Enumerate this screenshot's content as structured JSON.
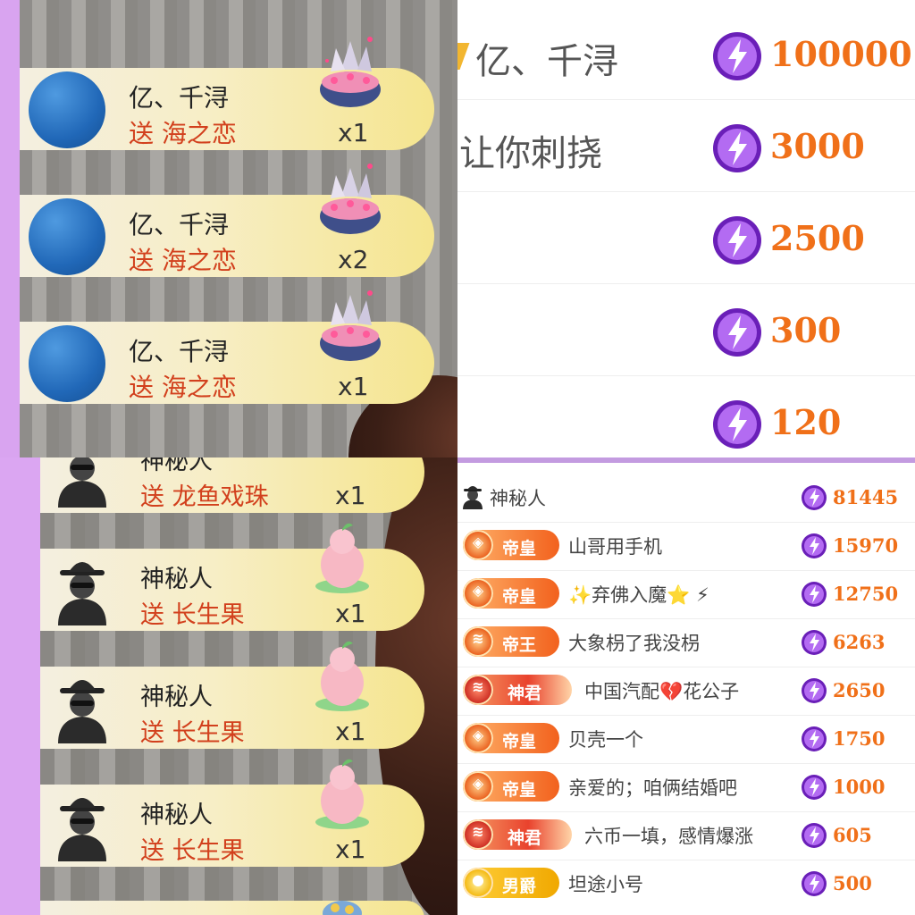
{
  "gift_feed_top": [
    {
      "name": "亿、千浔",
      "gift": "送 海之恋",
      "count": "x1"
    },
    {
      "name": "亿、千浔",
      "gift": "送 海之恋",
      "count": "x2"
    },
    {
      "name": "亿、千浔",
      "gift": "送 海之恋",
      "count": "x1"
    }
  ],
  "gift_feed_bottom": [
    {
      "name": "神秘人",
      "gift": "送 龙鱼戏珠",
      "count": "x1"
    },
    {
      "name": "神秘人",
      "gift": "送 长生果",
      "count": "x1"
    },
    {
      "name": "神秘人",
      "gift": "送 长生果",
      "count": "x1"
    },
    {
      "name": "神秘人",
      "gift": "送 长生果",
      "count": "x1"
    }
  ],
  "ranking_big": [
    {
      "name": "亿、千浔",
      "value": "100000"
    },
    {
      "name": "让你刺挠",
      "value": "3000"
    },
    {
      "name": "",
      "value": "2500"
    },
    {
      "name": "",
      "value": "300"
    },
    {
      "name": "",
      "value": "120"
    }
  ],
  "ranking_small": [
    {
      "badge": "",
      "badge_icon": "mystery-avatar-icon",
      "name": "神秘人",
      "value": "81445"
    },
    {
      "badge": "帝皇",
      "badge_icon": "diamond-icon",
      "name": "山哥用手机",
      "value": "15970"
    },
    {
      "badge": "帝皇",
      "badge_icon": "diamond-icon",
      "name": "✨弃佛入魔⭐ ⚡",
      "value": "12750"
    },
    {
      "badge": "帝王",
      "badge_icon": "chevron-icon",
      "name": "大象枴了我没枴",
      "value": "6263"
    },
    {
      "badge": "神君",
      "badge_icon": "chevron-icon",
      "name": "中国汽配💔花公子",
      "value": "2650"
    },
    {
      "badge": "帝皇",
      "badge_icon": "diamond-icon",
      "name": "贝壳一个",
      "value": "1750"
    },
    {
      "badge": "帝皇",
      "badge_icon": "diamond-icon",
      "name": "亲爱的；咱俩结婚吧",
      "value": "1000"
    },
    {
      "badge": "神君",
      "badge_icon": "chevron-icon",
      "name": "六币一填，感情爆涨",
      "value": "605"
    },
    {
      "badge": "男爵",
      "badge_icon": "circle-icon",
      "name": "坦途小号",
      "value": "500"
    }
  ],
  "colors": {
    "accent_orange": "#f07019",
    "coin_purple": "#8a2fd6",
    "gift_red": "#d2401d"
  }
}
